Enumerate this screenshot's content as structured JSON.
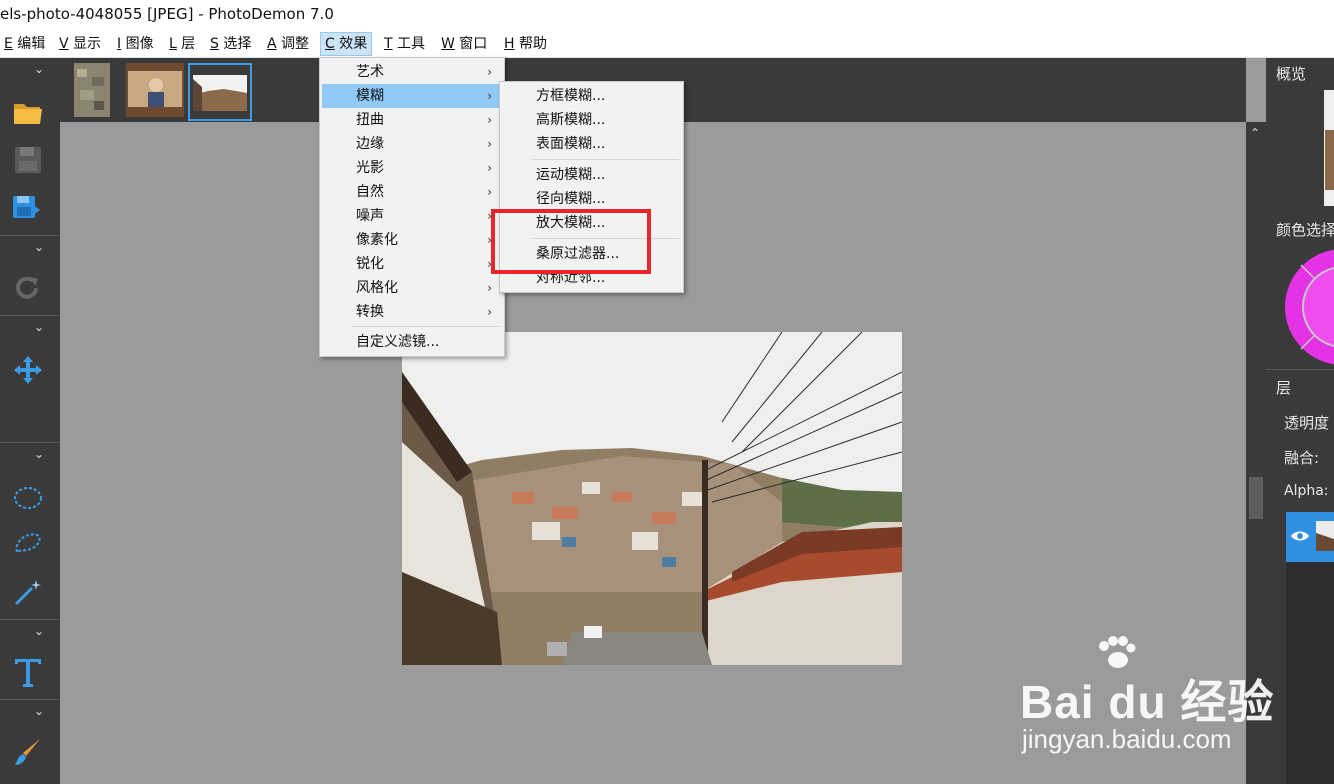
{
  "window": {
    "title": "els-photo-4048055 [JPEG]  -  PhotoDemon 7.0"
  },
  "menubar": {
    "items": [
      {
        "key": "E",
        "label": " 编辑"
      },
      {
        "key": "V",
        "label": " 显示"
      },
      {
        "key": "I",
        "label": " 图像"
      },
      {
        "key": "L",
        "label": " 层"
      },
      {
        "key": "S",
        "label": " 选择"
      },
      {
        "key": "A",
        "label": " 调整"
      },
      {
        "key": "C",
        "label": " 效果"
      },
      {
        "key": "T",
        "label": " 工具"
      },
      {
        "key": "W",
        "label": " 窗口"
      },
      {
        "key": "H",
        "label": " 帮助"
      }
    ]
  },
  "effects_menu": {
    "items": [
      "艺术",
      "模糊",
      "扭曲",
      "边缘",
      "光影",
      "自然",
      "噪声",
      "像素化",
      "锐化",
      "风格化",
      "转换"
    ],
    "custom": "自定义滤镜..."
  },
  "blur_submenu": {
    "items": [
      "方框模糊...",
      "高斯模糊...",
      "表面模糊...",
      "运动模糊...",
      "径向模糊...",
      "放大模糊...",
      "桑原过滤器...",
      "对称近邻..."
    ]
  },
  "right_panel": {
    "overview": "概览",
    "color_picker": "颜色选择",
    "layers": "层",
    "opacity": "透明度",
    "blend": "融合:",
    "alpha": "Alpha:"
  },
  "watermark": {
    "brand": "Bai du 经验",
    "url": "jingyan.baidu.com"
  },
  "colors": {
    "accent": "#3b9ce6",
    "highlight": "#91c9f7",
    "annotation": "#e8252a"
  }
}
